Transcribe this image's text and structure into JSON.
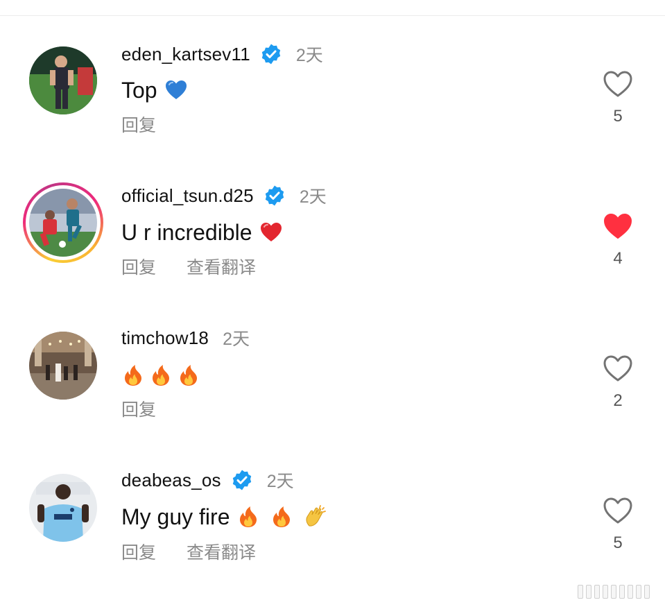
{
  "colors": {
    "verified_blue": "#1d9bf0",
    "liked_red": "#ff3040",
    "muted_text": "#8a8a8a",
    "primary_text": "#111111"
  },
  "comments": [
    {
      "username": "eden_kartsev11",
      "verified": true,
      "time": "2天",
      "text": "Top",
      "emojis": [
        "blue-heart"
      ],
      "actions": [
        "回复"
      ],
      "liked": false,
      "likes": "5",
      "has_story": false
    },
    {
      "username": "official_tsun.d25",
      "verified": true,
      "time": "2天",
      "text": "U r incredible",
      "emojis": [
        "red-heart"
      ],
      "actions": [
        "回复",
        "查看翻译"
      ],
      "liked": true,
      "likes": "4",
      "has_story": true
    },
    {
      "username": "timchow18",
      "verified": false,
      "time": "2天",
      "text": "",
      "emojis": [
        "fire",
        "fire",
        "fire"
      ],
      "actions": [
        "回复"
      ],
      "liked": false,
      "likes": "2",
      "has_story": false
    },
    {
      "username": "deabeas_os",
      "verified": true,
      "time": "2天",
      "text": "My guy fire",
      "emojis": [
        "fire",
        "fire",
        "clapping-hands"
      ],
      "actions": [
        "回复",
        "查看翻译"
      ],
      "liked": false,
      "likes": "5",
      "has_story": false
    }
  ]
}
